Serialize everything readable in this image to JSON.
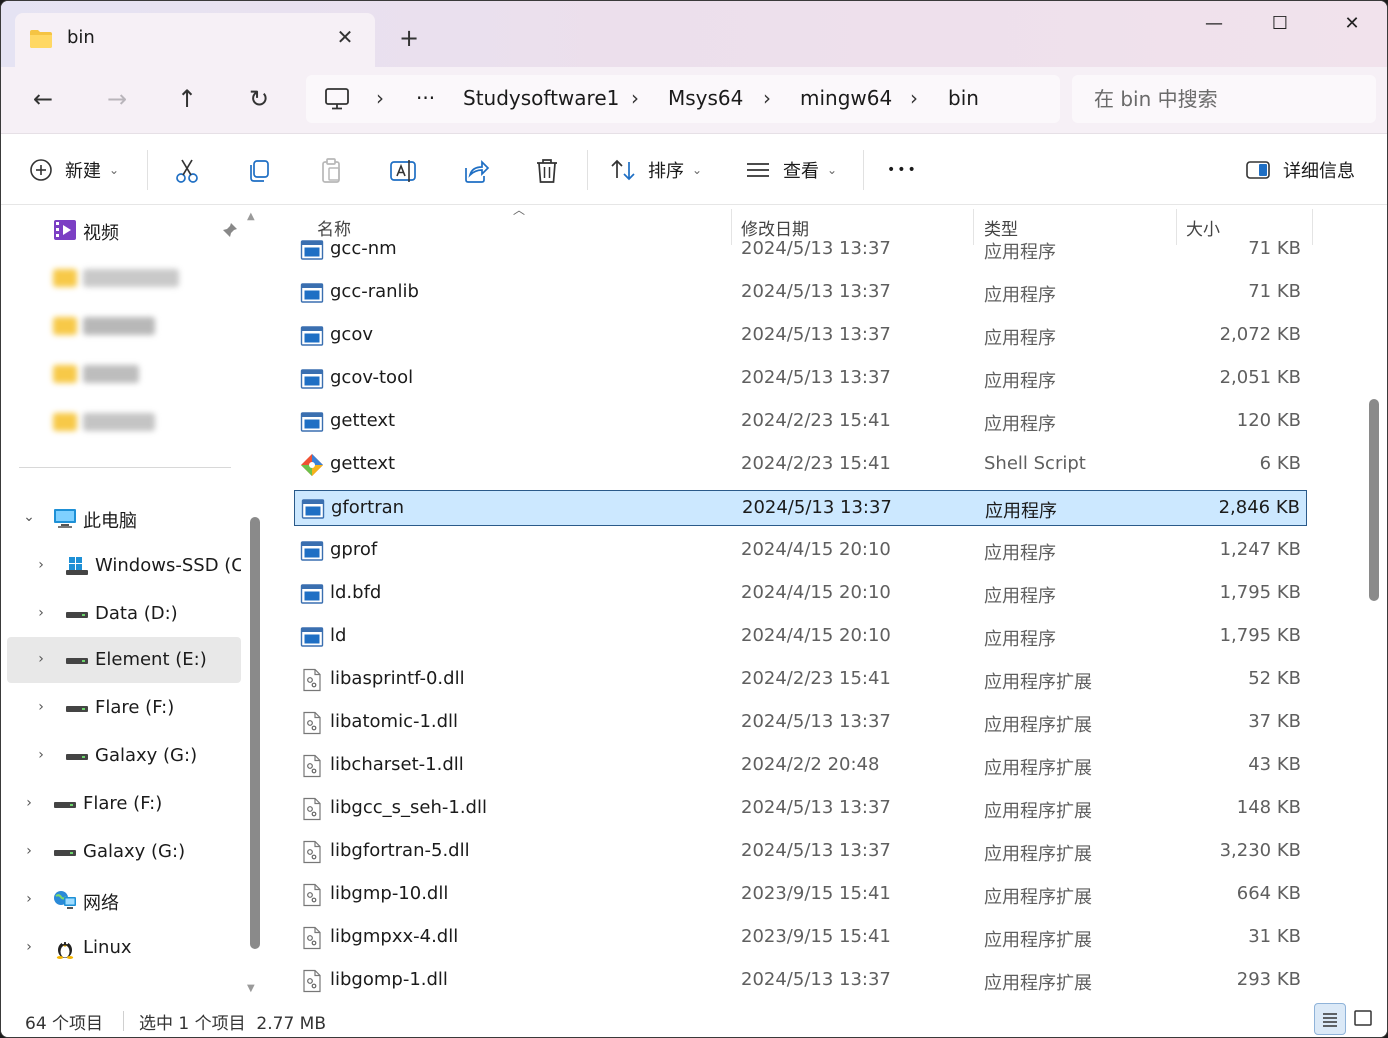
{
  "tab": {
    "title": "bin",
    "close_glyph": "✕",
    "new_glyph": "+"
  },
  "window_controls": {
    "minimize": "—",
    "maximize": "☐",
    "close": "✕"
  },
  "nav": {
    "back": "←",
    "forward": "→",
    "up": "↑",
    "refresh": "↻"
  },
  "address": {
    "ellipsis": "···",
    "sep": "›",
    "crumbs": [
      "Studysoftware1",
      "Msys64",
      "mingw64",
      "bin"
    ]
  },
  "search": {
    "placeholder": "在 bin 中搜索"
  },
  "toolbar": {
    "new_label": "新建",
    "sort_label": "排序",
    "view_label": "查看",
    "more_glyph": "•••",
    "details_label": "详细信息",
    "dropdown_glyph": "⌄"
  },
  "sidebar": {
    "video_label": "视频",
    "this_pc_label": "此电脑",
    "drives": [
      "Windows-SSD (C:)",
      "Data (D:)",
      "Element (E:)",
      "Flare (F:)",
      "Galaxy (G:)"
    ],
    "top_level": [
      "Flare (F:)",
      "Galaxy (G:)",
      "网络",
      "Linux"
    ],
    "chevron_right": "›",
    "chevron_down": "⌄"
  },
  "columns": {
    "name": "名称",
    "modified": "修改日期",
    "type": "类型",
    "size": "大小"
  },
  "files": [
    {
      "name": "gcc-nm",
      "date": "2024/5/13 13:37",
      "type": "应用程序",
      "size": "71 KB",
      "icon": "exe-icon"
    },
    {
      "name": "gcc-ranlib",
      "date": "2024/5/13 13:37",
      "type": "应用程序",
      "size": "71 KB",
      "icon": "exe-icon"
    },
    {
      "name": "gcov",
      "date": "2024/5/13 13:37",
      "type": "应用程序",
      "size": "2,072 KB",
      "icon": "exe-icon"
    },
    {
      "name": "gcov-tool",
      "date": "2024/5/13 13:37",
      "type": "应用程序",
      "size": "2,051 KB",
      "icon": "exe-icon"
    },
    {
      "name": "gettext",
      "date": "2024/2/23 15:41",
      "type": "应用程序",
      "size": "120 KB",
      "icon": "exe-icon"
    },
    {
      "name": "gettext",
      "date": "2024/2/23 15:41",
      "type": "Shell Script",
      "size": "6 KB",
      "icon": "git-script-icon"
    },
    {
      "name": "gfortran",
      "date": "2024/5/13 13:37",
      "type": "应用程序",
      "size": "2,846 KB",
      "icon": "exe-icon"
    },
    {
      "name": "gprof",
      "date": "2024/4/15 20:10",
      "type": "应用程序",
      "size": "1,247 KB",
      "icon": "exe-icon"
    },
    {
      "name": "ld.bfd",
      "date": "2024/4/15 20:10",
      "type": "应用程序",
      "size": "1,795 KB",
      "icon": "exe-icon"
    },
    {
      "name": "ld",
      "date": "2024/4/15 20:10",
      "type": "应用程序",
      "size": "1,795 KB",
      "icon": "exe-icon"
    },
    {
      "name": "libasprintf-0.dll",
      "date": "2024/2/23 15:41",
      "type": "应用程序扩展",
      "size": "52 KB",
      "icon": "dll-icon"
    },
    {
      "name": "libatomic-1.dll",
      "date": "2024/5/13 13:37",
      "type": "应用程序扩展",
      "size": "37 KB",
      "icon": "dll-icon"
    },
    {
      "name": "libcharset-1.dll",
      "date": "2024/2/2 20:48",
      "type": "应用程序扩展",
      "size": "43 KB",
      "icon": "dll-icon"
    },
    {
      "name": "libgcc_s_seh-1.dll",
      "date": "2024/5/13 13:37",
      "type": "应用程序扩展",
      "size": "148 KB",
      "icon": "dll-icon"
    },
    {
      "name": "libgfortran-5.dll",
      "date": "2024/5/13 13:37",
      "type": "应用程序扩展",
      "size": "3,230 KB",
      "icon": "dll-icon"
    },
    {
      "name": "libgmp-10.dll",
      "date": "2023/9/15 15:41",
      "type": "应用程序扩展",
      "size": "664 KB",
      "icon": "dll-icon"
    },
    {
      "name": "libgmpxx-4.dll",
      "date": "2023/9/15 15:41",
      "type": "应用程序扩展",
      "size": "31 KB",
      "icon": "dll-icon"
    },
    {
      "name": "libgomp-1.dll",
      "date": "2024/5/13 13:37",
      "type": "应用程序扩展",
      "size": "293 KB",
      "icon": "dll-icon"
    }
  ],
  "selected_file_index": 6,
  "status": {
    "count": "64 个项目",
    "selection": "选中 1 个项目  2.77 MB"
  },
  "colors": {
    "selection_bg": "#cce8ff",
    "selection_border": "#2a5a8a",
    "accent": "#0067c0",
    "folder": "#f5c443"
  }
}
